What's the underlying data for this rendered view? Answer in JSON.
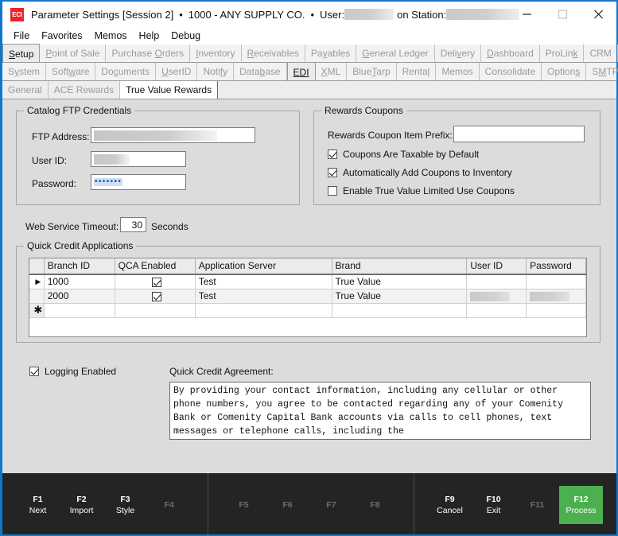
{
  "titlebar": {
    "logo_text": "ECI",
    "title": "Parameter Settings [Session 2]",
    "separator": "•",
    "company": "1000 - ANY SUPPLY CO.",
    "user_label": "User:",
    "station_label": "on Station:",
    "minimize_icon": "minimize-icon",
    "maximize_icon": "maximize-icon",
    "close_icon": "close-icon"
  },
  "menubar": {
    "items": [
      {
        "label": "File"
      },
      {
        "label": "Favorites"
      },
      {
        "label": "Memos"
      },
      {
        "label": "Help"
      },
      {
        "label": "Debug"
      }
    ]
  },
  "tabs_row1": [
    {
      "label": "Setup",
      "accel": "S",
      "active": true
    },
    {
      "label": "Point of Sale",
      "accel": "P",
      "active": false
    },
    {
      "label": "Purchase Orders",
      "accel": "O",
      "active": false
    },
    {
      "label": "Inventory",
      "accel": "I",
      "active": false
    },
    {
      "label": "Receivables",
      "accel": "R",
      "active": false
    },
    {
      "label": "Payables",
      "accel": "y",
      "active": false
    },
    {
      "label": "General Ledger",
      "accel": "G",
      "active": false
    },
    {
      "label": "Delivery",
      "accel": "v",
      "active": false
    },
    {
      "label": "Dashboard",
      "accel": "D",
      "active": false
    },
    {
      "label": "ProLink",
      "accel": "k",
      "active": false
    },
    {
      "label": "CRM",
      "accel": "",
      "active": false
    }
  ],
  "tabs_row2": [
    {
      "label": "System",
      "accel": "y",
      "active": false
    },
    {
      "label": "Software",
      "accel": "w",
      "active": false
    },
    {
      "label": "Documents",
      "accel": "c",
      "active": false
    },
    {
      "label": "UserID",
      "accel": "U",
      "active": false
    },
    {
      "label": "Notify",
      "accel": "f",
      "active": false
    },
    {
      "label": "Database",
      "accel": "b",
      "active": false
    },
    {
      "label": "EDI",
      "accel": "EDI",
      "active": true
    },
    {
      "label": "XML",
      "accel": "X",
      "active": false
    },
    {
      "label": "BlueTarp",
      "accel": "T",
      "active": false
    },
    {
      "label": "Rental",
      "accel": "l",
      "active": false
    },
    {
      "label": "Memos",
      "accel": "",
      "active": false
    },
    {
      "label": "Consolidate",
      "accel": "",
      "active": false
    },
    {
      "label": "Options",
      "accel": "s",
      "active": false
    },
    {
      "label": "SMTP",
      "accel": "M",
      "active": false
    }
  ],
  "tabs_row3": [
    {
      "label": "General",
      "active": false
    },
    {
      "label": "ACE Rewards",
      "active": false
    },
    {
      "label": "True Value Rewards",
      "active": true
    }
  ],
  "ftp_group": {
    "title": "Catalog FTP Credentials",
    "ftp_address_label": "FTP Address:",
    "ftp_address_value": "",
    "user_id_label": "User ID:",
    "user_id_value": "",
    "password_label": "Password:",
    "password_value": "•••••••"
  },
  "rewards_group": {
    "title": "Rewards Coupons",
    "prefix_label": "Rewards Coupon Item Prefix:",
    "prefix_value": "",
    "checkboxes": [
      {
        "label": "Coupons Are Taxable by Default",
        "checked": true
      },
      {
        "label": "Automatically Add Coupons to Inventory",
        "checked": true
      },
      {
        "label": "Enable True Value Limited Use Coupons",
        "checked": false
      }
    ]
  },
  "timeout": {
    "label": "Web Service Timeout:",
    "value": "30",
    "unit": "Seconds"
  },
  "qca_group": {
    "title": "Quick Credit Applications",
    "columns": [
      "Branch ID",
      "QCA Enabled",
      "Application Server",
      "Brand",
      "User ID",
      "Password"
    ],
    "rows": [
      {
        "selector": "▶",
        "branch_id": "1000",
        "qca_enabled": true,
        "application_server": "Test",
        "brand": "True Value",
        "user_id": "",
        "password": "",
        "current": true,
        "redacted": false
      },
      {
        "selector": "",
        "branch_id": "2000",
        "qca_enabled": true,
        "application_server": "Test",
        "brand": "True Value",
        "user_id": "",
        "password": "",
        "current": false,
        "redacted": true
      }
    ],
    "new_row_marker": "✱"
  },
  "logging": {
    "label": "Logging Enabled",
    "checked": true
  },
  "agreement": {
    "label": "Quick Credit Agreement:",
    "text": "By providing your contact information, including any cellular or other phone numbers, you agree to be contacted regarding any of your Comenity Bank or Comenity Capital Bank accounts via calls to cell phones, text messages or telephone calls, including the"
  },
  "function_keys": {
    "group1": [
      {
        "key": "F1",
        "label": "Next",
        "enabled": true,
        "highlight": false
      },
      {
        "key": "F2",
        "label": "Import",
        "enabled": true,
        "highlight": false
      },
      {
        "key": "F3",
        "label": "Style",
        "enabled": true,
        "highlight": false
      },
      {
        "key": "F4",
        "label": "",
        "enabled": false,
        "highlight": false
      }
    ],
    "group2": [
      {
        "key": "F5",
        "label": "",
        "enabled": false,
        "highlight": false
      },
      {
        "key": "F6",
        "label": "",
        "enabled": false,
        "highlight": false
      },
      {
        "key": "F7",
        "label": "",
        "enabled": false,
        "highlight": false
      },
      {
        "key": "F8",
        "label": "",
        "enabled": false,
        "highlight": false
      }
    ],
    "group3": [
      {
        "key": "F9",
        "label": "Cancel",
        "enabled": true,
        "highlight": false
      },
      {
        "key": "F10",
        "label": "Exit",
        "enabled": true,
        "highlight": false
      },
      {
        "key": "F11",
        "label": "",
        "enabled": false,
        "highlight": false
      },
      {
        "key": "F12",
        "label": "Process",
        "enabled": true,
        "highlight": true
      }
    ]
  },
  "colors": {
    "window_border": "#1177cc",
    "body_background": "#dcdcdc",
    "fnbar_background": "#242424",
    "process_green": "#4cb050",
    "logo_red": "#e8252a"
  }
}
